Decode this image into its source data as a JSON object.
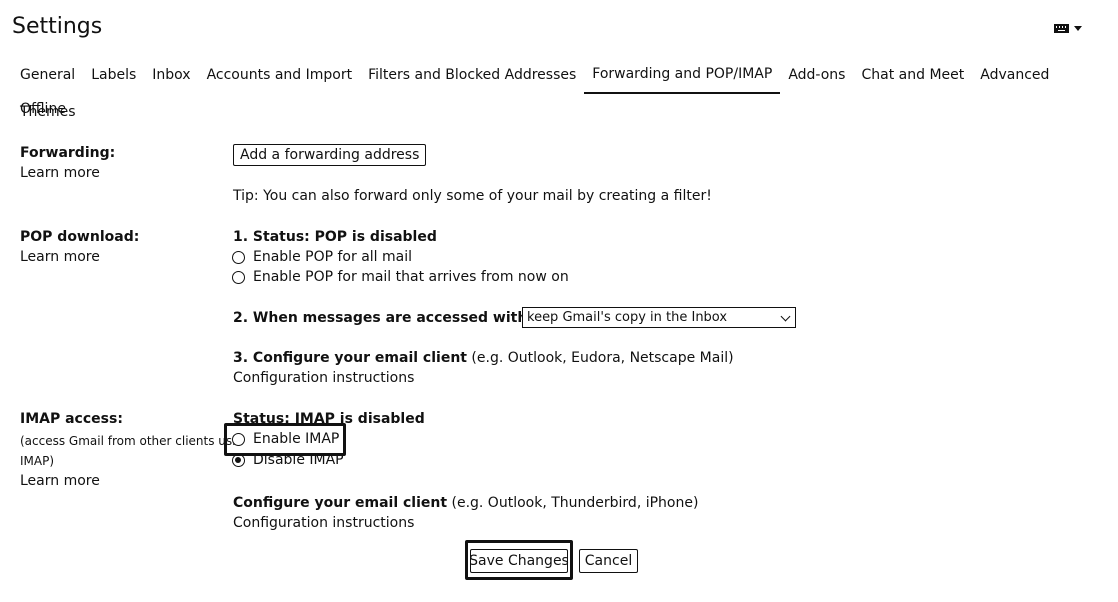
{
  "header": {
    "title": "Settings",
    "input_tools_icon": "keyboard-icon",
    "dropdown_icon": "caret-down-icon"
  },
  "tabs": [
    {
      "label": "General"
    },
    {
      "label": "Labels"
    },
    {
      "label": "Inbox"
    },
    {
      "label": "Accounts and Import"
    },
    {
      "label": "Filters and Blocked Addresses"
    },
    {
      "label": "Forwarding and POP/IMAP",
      "active": true
    },
    {
      "label": "Add-ons"
    },
    {
      "label": "Chat and Meet"
    },
    {
      "label": "Advanced"
    },
    {
      "label": "Offline"
    },
    {
      "label": "Themes"
    }
  ],
  "forwarding": {
    "label": "Forwarding:",
    "learn_more": "Learn more",
    "add_button": "Add a forwarding address",
    "tip": "Tip: You can also forward only some of your mail by creating a filter!"
  },
  "pop": {
    "label": "POP download:",
    "learn_more": "Learn more",
    "status": "1. Status: POP is disabled",
    "option_all": "Enable POP for all mail",
    "option_now": "Enable POP for mail that arrives from now on",
    "when_accessed": "2. When messages are accessed with POP",
    "when_accessed_select": "keep Gmail's copy in the Inbox",
    "configure_bold": "3. Configure your email client",
    "configure_rest": " (e.g. Outlook, Eudora, Netscape Mail)",
    "config_instructions": "Configuration instructions"
  },
  "imap": {
    "label": "IMAP access:",
    "note_line1": "(access Gmail from other clients usin",
    "note_line2": "IMAP)",
    "learn_more": "Learn more",
    "status": "Status: IMAP is disabled",
    "enable": "Enable IMAP",
    "disable": "Disable IMAP",
    "enable_checked": false,
    "disable_checked": true,
    "configure_bold": "Configure your email client",
    "configure_rest": " (e.g. Outlook, Thunderbird, iPhone)",
    "config_instructions": "Configuration instructions"
  },
  "footer": {
    "save": "Save Changes",
    "cancel": "Cancel"
  }
}
